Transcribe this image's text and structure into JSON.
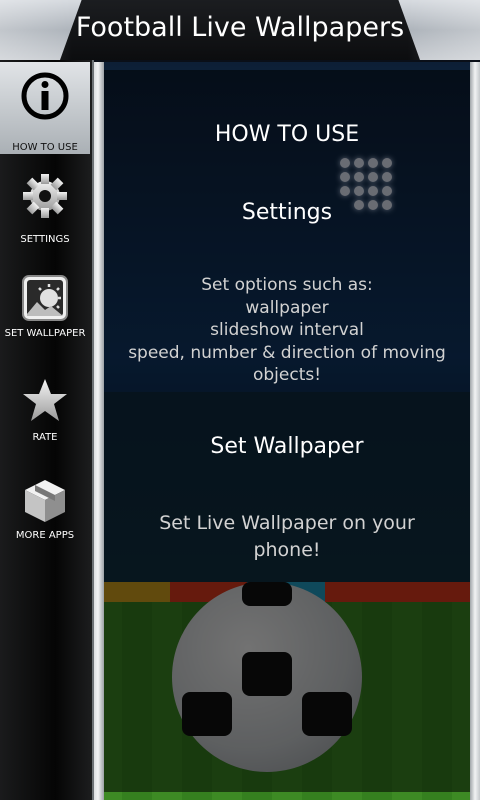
{
  "header": {
    "title": "Football Live Wallpapers"
  },
  "sidebar": {
    "items": [
      {
        "label": "HOW TO USE",
        "icon": "info-icon",
        "active": true
      },
      {
        "label": "SETTINGS",
        "icon": "gear-icon"
      },
      {
        "label": "SET WALLPAPER",
        "icon": "wallpaper-icon"
      },
      {
        "label": "RATE",
        "icon": "star-icon"
      },
      {
        "label": "MORE APPS",
        "icon": "box-icon"
      }
    ]
  },
  "content": {
    "heading": "HOW TO USE",
    "settings_heading": "Settings",
    "settings_lines": [
      "Set options such as:",
      "wallpaper",
      "slideshow interval",
      "speed, number & direction of moving",
      "objects!"
    ],
    "wallpaper_heading": "Set Wallpaper",
    "wallpaper_lines": [
      "Set Live Wallpaper on your",
      "phone!"
    ]
  },
  "colors": {
    "accent_active": "#cfd3d6",
    "sidebar_bg": "#050505"
  }
}
